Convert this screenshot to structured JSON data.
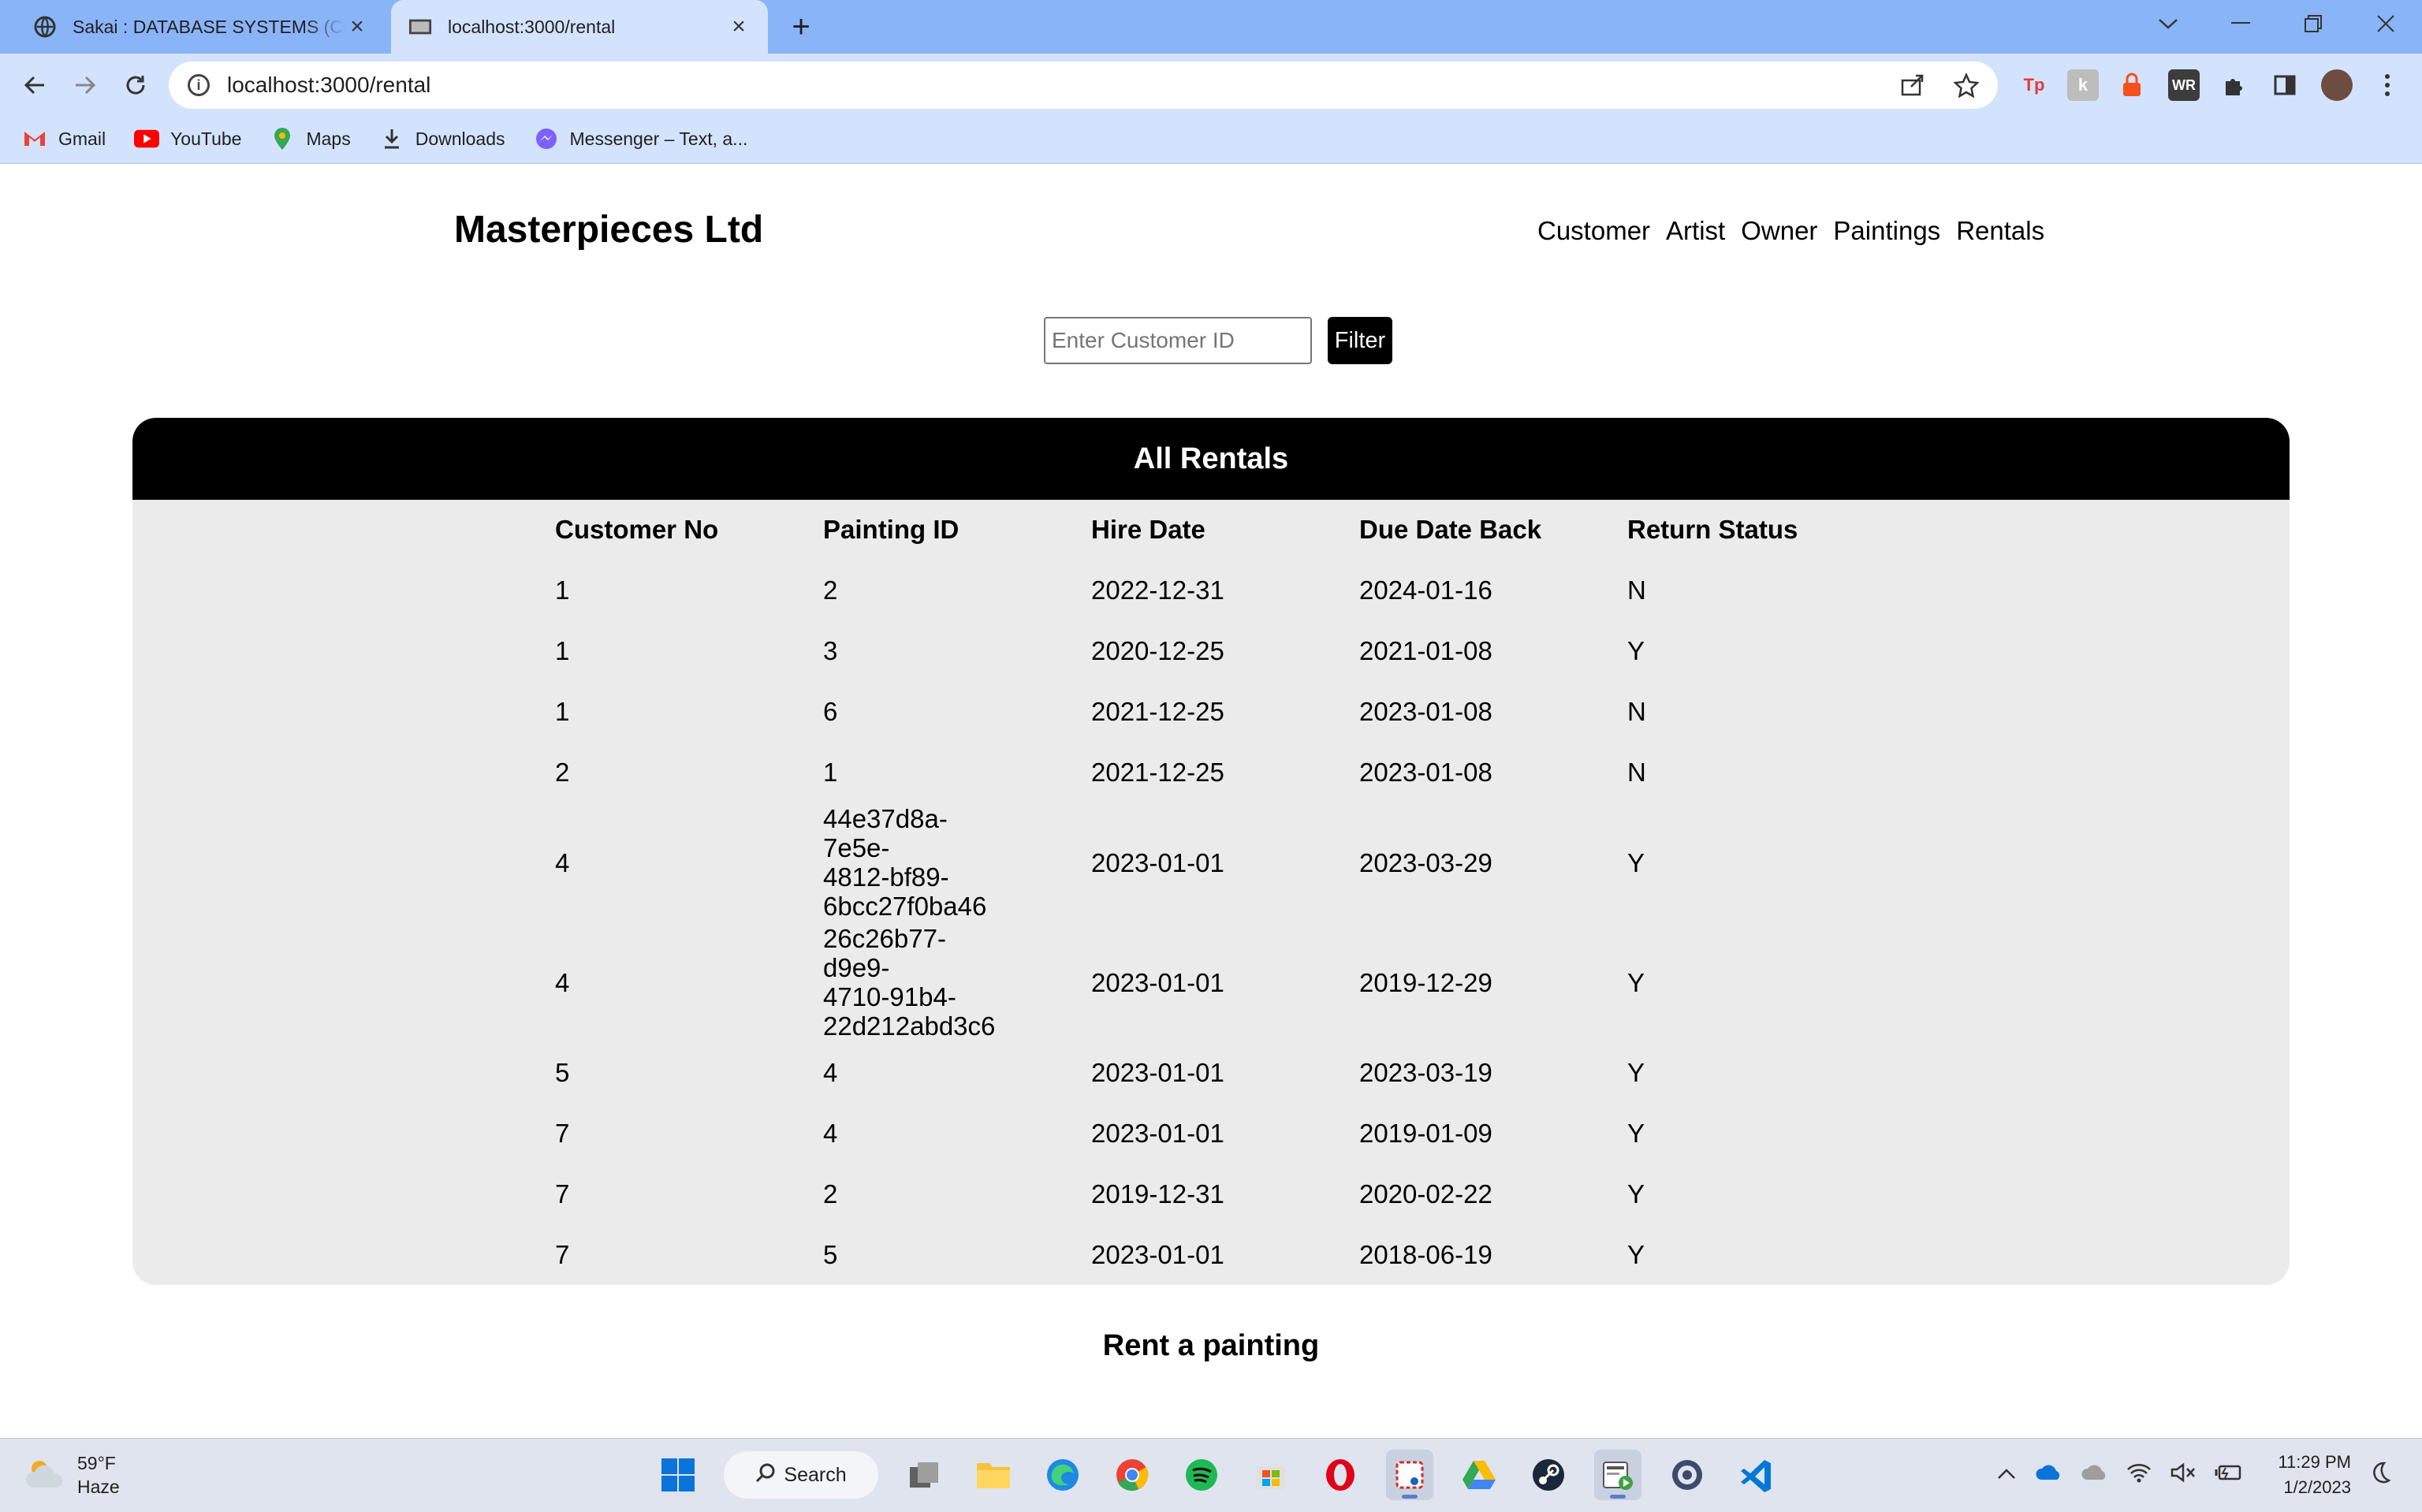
{
  "browser": {
    "tabs": [
      {
        "title": "Sakai : DATABASE SYSTEMS (Class",
        "active": false
      },
      {
        "title": "localhost:3000/rental",
        "active": true
      }
    ],
    "url": "localhost:3000/rental",
    "bookmarks": [
      {
        "label": "Gmail",
        "icon": "gmail-icon"
      },
      {
        "label": "YouTube",
        "icon": "youtube-icon"
      },
      {
        "label": "Maps",
        "icon": "maps-icon"
      },
      {
        "label": "Downloads",
        "icon": "download-icon"
      },
      {
        "label": "Messenger – Text, a...",
        "icon": "messenger-icon"
      }
    ]
  },
  "site": {
    "brand": "Masterpieces Ltd",
    "nav": [
      "Customer",
      "Artist",
      "Owner",
      "Paintings",
      "Rentals"
    ]
  },
  "filter": {
    "placeholder": "Enter Customer ID",
    "value": "",
    "button": "Filter"
  },
  "rentals": {
    "heading": "All Rentals",
    "columns": [
      "Customer No",
      "Painting ID",
      "Hire Date",
      "Due Date Back",
      "Return Status"
    ],
    "rows": [
      [
        "1",
        "2",
        "2022-12-31",
        "2024-01-16",
        "N"
      ],
      [
        "1",
        "3",
        "2020-12-25",
        "2021-01-08",
        "Y"
      ],
      [
        "1",
        "6",
        "2021-12-25",
        "2023-01-08",
        "N"
      ],
      [
        "2",
        "1",
        "2021-12-25",
        "2023-01-08",
        "N"
      ],
      [
        "4",
        "44e37d8a-7e5e-4812-bf89-6bcc27f0ba46",
        "2023-01-01",
        "2023-03-29",
        "Y"
      ],
      [
        "4",
        "26c26b77-d9e9-4710-91b4-22d212abd3c6",
        "2023-01-01",
        "2019-12-29",
        "Y"
      ],
      [
        "5",
        "4",
        "2023-01-01",
        "2023-03-19",
        "Y"
      ],
      [
        "7",
        "4",
        "2023-01-01",
        "2019-01-09",
        "Y"
      ],
      [
        "7",
        "2",
        "2019-12-31",
        "2020-02-22",
        "Y"
      ],
      [
        "7",
        "5",
        "2023-01-01",
        "2018-06-19",
        "Y"
      ]
    ]
  },
  "rent_section": {
    "heading": "Rent a painting"
  },
  "taskbar": {
    "weather_temp": "59°F",
    "weather_desc": "Haze",
    "search_label": "Search",
    "time": "11:29 PM",
    "date": "1/2/2023"
  },
  "colors": {
    "tabstrip": "#8ab4f8",
    "toolbar": "#d3e3fd",
    "panel_bg": "#ebebeb",
    "panel_header": "#000000",
    "filter_button": "#000000"
  }
}
